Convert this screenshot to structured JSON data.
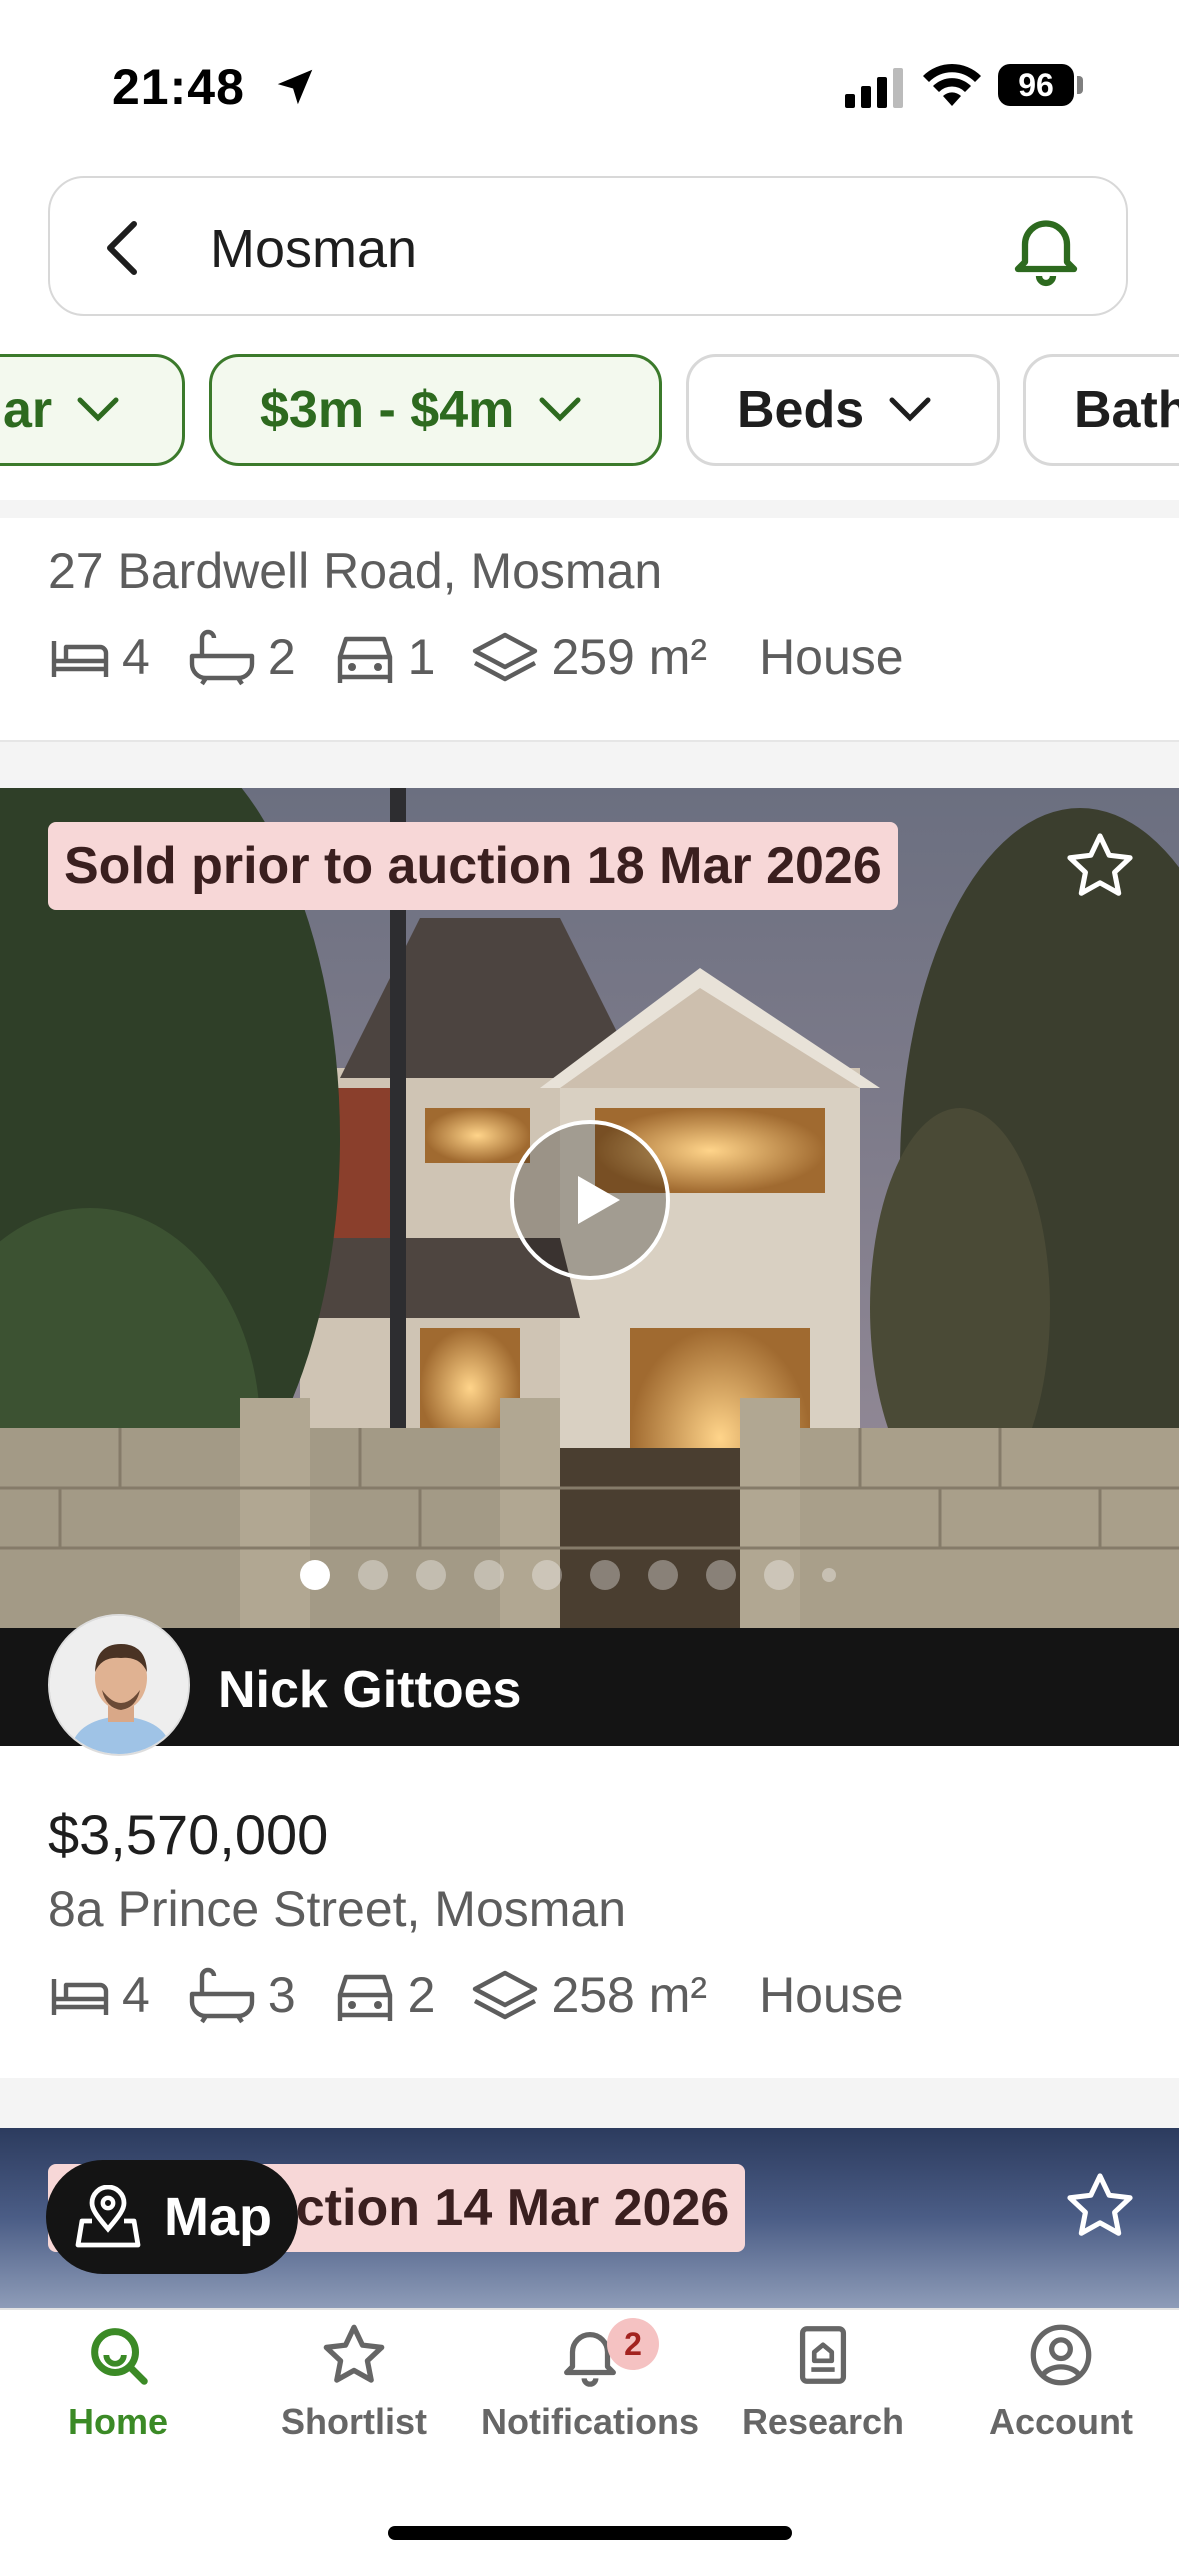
{
  "status_bar": {
    "time": "21:48",
    "battery": "96"
  },
  "search": {
    "query": "Mosman"
  },
  "filters": [
    {
      "label": "ar",
      "active": true
    },
    {
      "label": "$3m - $4m",
      "active": true
    },
    {
      "label": "Beds",
      "active": false
    },
    {
      "label": "Bath",
      "active": false
    }
  ],
  "listings": [
    {
      "address": "27 Bardwell Road, Mosman",
      "beds": "4",
      "baths": "2",
      "cars": "1",
      "area": "259 m²",
      "type": "House"
    },
    {
      "badge": "Sold prior to auction 18 Mar 2026",
      "agent": "Nick Gittoes",
      "price": "$3,570,000",
      "address": "8a Prince Street, Mosman",
      "beds": "4",
      "baths": "3",
      "cars": "2",
      "area": "258 m²",
      "type": "House"
    },
    {
      "badge": "uction 14 Mar 2026"
    }
  ],
  "map_button": {
    "label": "Map"
  },
  "tabs": [
    {
      "label": "Home",
      "icon": "home-search-icon",
      "active": true
    },
    {
      "label": "Shortlist",
      "icon": "star-icon"
    },
    {
      "label": "Notifications",
      "icon": "bell-icon",
      "badge": "2"
    },
    {
      "label": "Research",
      "icon": "research-icon"
    },
    {
      "label": "Account",
      "icon": "account-icon"
    }
  ],
  "colors": {
    "accent": "#3b8a26",
    "badge_bg": "#f7d7d7",
    "dark_bar": "#141414"
  }
}
